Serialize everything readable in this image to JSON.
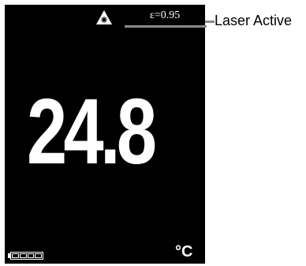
{
  "status_bar": {
    "laser_icon": "laser-warning-icon",
    "emissivity": "ε=0.95"
  },
  "callout": {
    "label": "Laser Active"
  },
  "measurement": {
    "value": "24.8",
    "unit": "°C"
  },
  "battery": {
    "icon": "battery-icon",
    "level": 1.0
  },
  "colors": {
    "screen_bg": "#000000",
    "text": "#ffffff",
    "leader_line": "#8a8a8a"
  }
}
